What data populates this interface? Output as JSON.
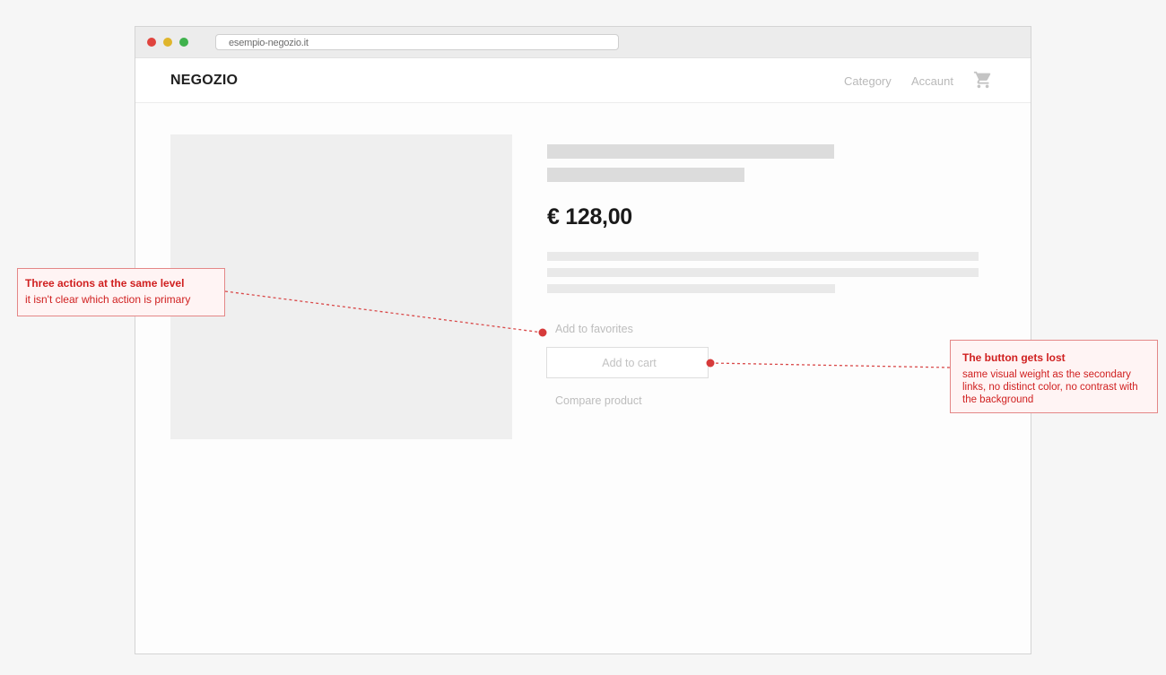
{
  "browser": {
    "url": "esempio-negozio.it",
    "window_dots": [
      "close",
      "minimize",
      "maximize"
    ]
  },
  "header": {
    "brand": "NEGOZIO",
    "nav": [
      "Category",
      "Accaunt"
    ],
    "cart_icon": "cart-icon"
  },
  "product": {
    "price": "€ 128,00",
    "actions": {
      "favorites": "Add to favorites",
      "add_to_cart": "Add to cart",
      "compare": "Compare product"
    }
  },
  "annotations": [
    {
      "title": "Three actions at the same level",
      "body": "it isn't clear which action is primary"
    },
    {
      "title": "The button gets lost",
      "body": "same visual weight as the secondary links, no distinct color, no contrast with the background"
    }
  ],
  "colors": {
    "annotation_text": "#d02020",
    "annotation_border": "#e48787",
    "annotation_bg": "#fff4f4",
    "dot_red": "#e0443e",
    "dot_yellow": "#dfb52c",
    "dot_green": "#3fb14c"
  }
}
